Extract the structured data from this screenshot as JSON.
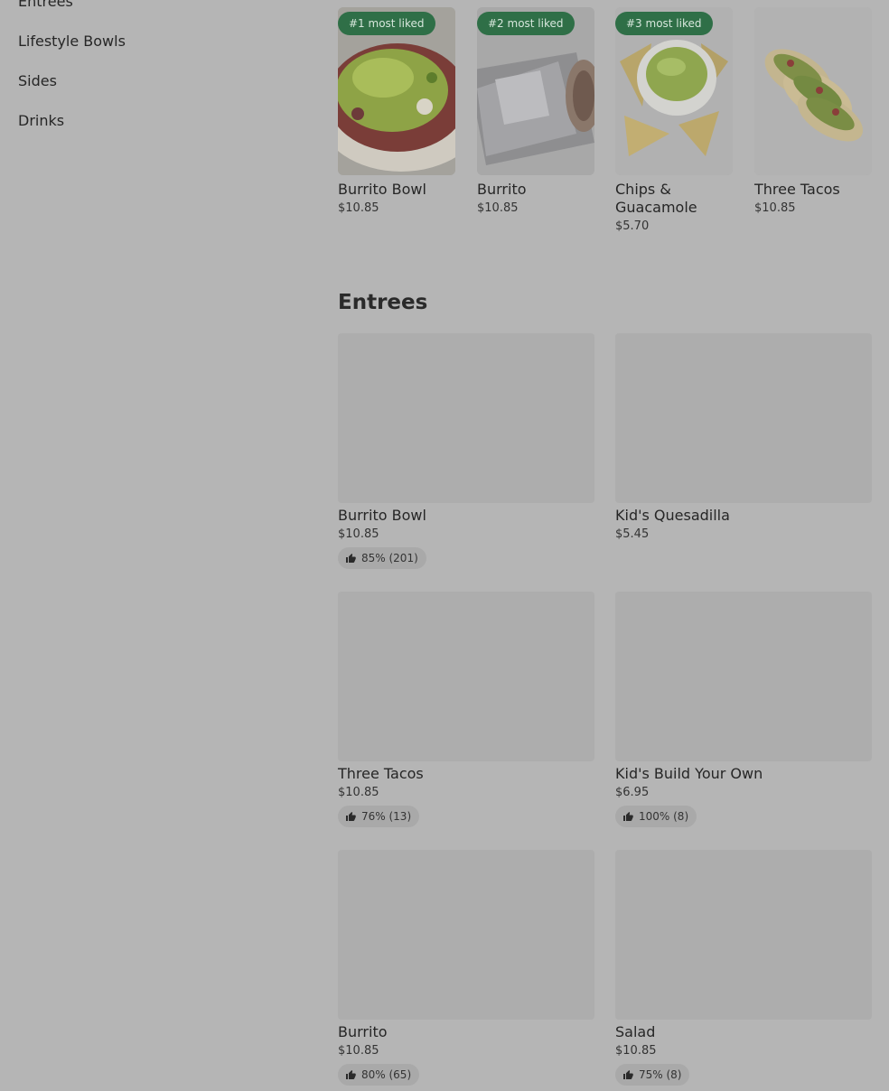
{
  "sidebar": {
    "items": [
      {
        "label": "Entrees"
      },
      {
        "label": "Lifestyle Bowls"
      },
      {
        "label": "Sides"
      },
      {
        "label": "Drinks"
      }
    ]
  },
  "most_liked": [
    {
      "badge": "#1 most liked",
      "name": "Burrito Bowl",
      "price": "$10.85"
    },
    {
      "badge": "#2 most liked",
      "name": "Burrito",
      "price": "$10.85"
    },
    {
      "badge": "#3 most liked",
      "name": "Chips & Guacamole",
      "price": "$5.70"
    },
    {
      "badge": "",
      "name": "Three Tacos",
      "price": "$10.85"
    }
  ],
  "entrees": {
    "title": "Entrees",
    "items": [
      {
        "name": "Burrito Bowl",
        "price": "$10.85",
        "rating": "85% (201)"
      },
      {
        "name": "Kid's Quesadilla",
        "price": "$5.45",
        "rating": ""
      },
      {
        "name": "Three Tacos",
        "price": "$10.85",
        "rating": "76% (13)"
      },
      {
        "name": "Kid's Build Your Own",
        "price": "$6.95",
        "rating": "100% (8)"
      },
      {
        "name": "Burrito",
        "price": "$10.85",
        "rating": "80% (65)"
      },
      {
        "name": "Salad",
        "price": "$10.85",
        "rating": "75% (8)"
      }
    ]
  },
  "colors": {
    "overlay_bg": "#b5b5b5",
    "badge_green": "#2f6f47"
  }
}
